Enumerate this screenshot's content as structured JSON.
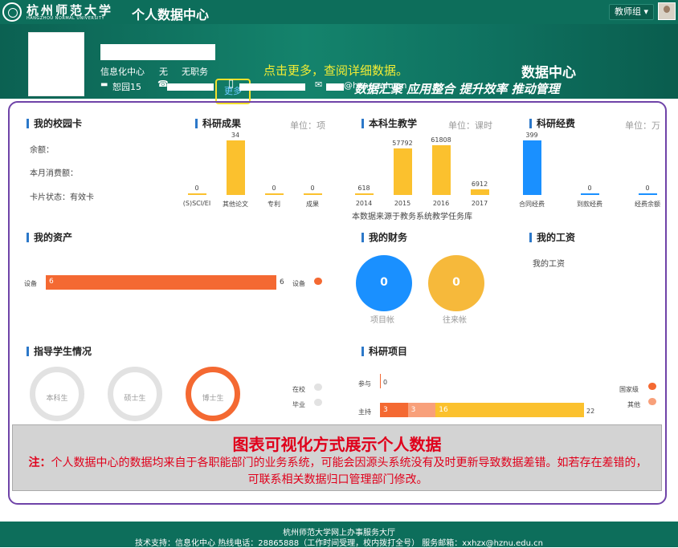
{
  "header": {
    "logo_name": "杭州师范大学",
    "logo_en": "HANGZHOU NORMAL UNIVERSITY",
    "app_title": "个人数据中心",
    "user_group": "教师组 ▾"
  },
  "profile": {
    "dept": "信息化中心",
    "title_a": "无",
    "title_b": "无职务",
    "more_label": "更多",
    "office": "恕园15",
    "email_suffix": "@hznu.edu.cn"
  },
  "banner": {
    "hint": "点击更多，查阅详细数据。",
    "center_title": "数据中心",
    "slogan": "数据汇聚  应用整合  提升效率  推动管理"
  },
  "campus_card": {
    "title": "我的校园卡",
    "balance_label": "余额：",
    "month_spend_label": "本月消费额：",
    "status_label": "卡片状态：有效卡"
  },
  "research_output": {
    "title": "科研成果",
    "unit": "单位：项",
    "categories": [
      "(S)SCI/EI",
      "其他论文",
      "专利",
      "成果"
    ],
    "values": [
      0,
      34,
      0,
      0
    ]
  },
  "teaching": {
    "title": "本科生教学",
    "unit": "单位：课时",
    "categories": [
      "2014",
      "2015",
      "2016",
      "2017"
    ],
    "values": [
      618,
      57792,
      61808,
      6912
    ],
    "source": "本数据来源于教务系统教学任务库"
  },
  "funding": {
    "title": "科研经费",
    "unit": "单位：万",
    "categories": [
      "合同经费",
      "到款经费",
      "经费余额"
    ],
    "values": [
      399,
      0,
      0
    ]
  },
  "assets": {
    "title": "我的资产",
    "bar_label": "设备",
    "bar_value": "6",
    "bar_end": "6",
    "legend": "设备",
    "color": "#f46932"
  },
  "finance": {
    "title": "我的财务",
    "project_value": "0",
    "project_label": "项目帐",
    "current_value": "0",
    "current_label": "往来帐"
  },
  "salary": {
    "title": "我的工资",
    "text": "我的工资"
  },
  "students": {
    "title": "指导学生情况",
    "rings": [
      "本科生",
      "硕士生",
      "博士生"
    ],
    "legend_current": "在校",
    "legend_graduated": "毕业"
  },
  "projects": {
    "title": "科研项目",
    "rows": [
      {
        "label": "参与",
        "total": "0"
      },
      {
        "label": "主持",
        "total": "22"
      }
    ],
    "segments": [
      {
        "value": 3,
        "color": "#f46932"
      },
      {
        "value": 3,
        "color": "#f8a07a"
      },
      {
        "value": 16,
        "color": "#fbc12e"
      }
    ],
    "legend_national": "国家级",
    "legend_other": "其他"
  },
  "notice": {
    "heading": "图表可视化方式展示个人数据",
    "prefix": "注：",
    "body": "个人数据中心的数据均来自于各职能部门的业务系统，可能会因源头系统没有及时更新导致数据差错。如若存在差错的，可联系相关数据归口管理部门修改。"
  },
  "footer": {
    "line1": "杭州师范大学网上办事服务大厅",
    "line2": "技术支持：信息化中心 热线电话：28865888（工作时间受理，校内拨打全号） 服务邮箱：xxhzx@hznu.edu.cn"
  }
}
